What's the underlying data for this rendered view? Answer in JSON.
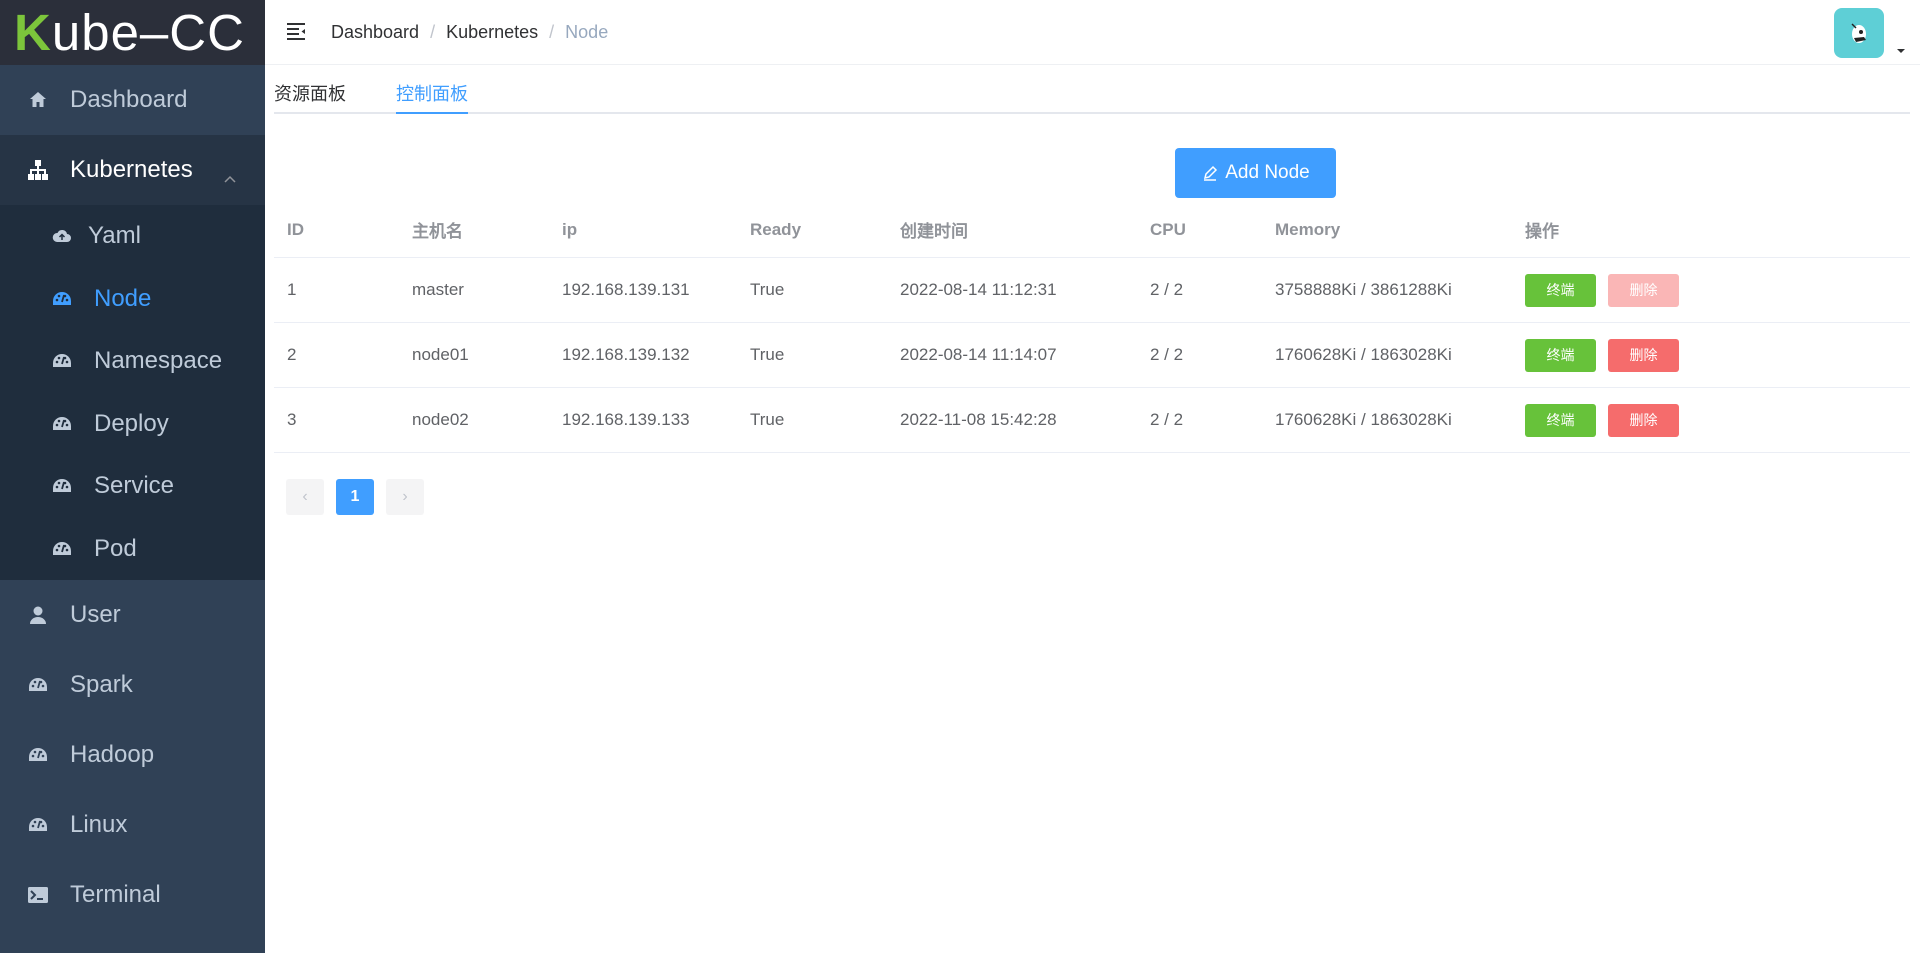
{
  "app": {
    "logo_prefix": "K",
    "logo_rest": "ube–CC"
  },
  "sidebar": {
    "items": [
      {
        "label": "Dashboard",
        "icon": "home-icon"
      },
      {
        "label": "Kubernetes",
        "icon": "sitemap-icon",
        "expanded": true,
        "children": [
          {
            "label": "Yaml",
            "icon": "cloud-upload-icon"
          },
          {
            "label": "Node",
            "icon": "dashboard-gauge-icon",
            "active": true
          },
          {
            "label": "Namespace",
            "icon": "dashboard-gauge-icon"
          },
          {
            "label": "Deploy",
            "icon": "dashboard-gauge-icon"
          },
          {
            "label": "Service",
            "icon": "dashboard-gauge-icon"
          },
          {
            "label": "Pod",
            "icon": "dashboard-gauge-icon"
          }
        ]
      },
      {
        "label": "User",
        "icon": "user-icon"
      },
      {
        "label": "Spark",
        "icon": "dashboard-gauge-icon"
      },
      {
        "label": "Hadoop",
        "icon": "dashboard-gauge-icon"
      },
      {
        "label": "Linux",
        "icon": "dashboard-gauge-icon"
      },
      {
        "label": "Terminal",
        "icon": "terminal-icon"
      }
    ]
  },
  "breadcrumb": [
    "Dashboard",
    "Kubernetes",
    "Node"
  ],
  "tabs": [
    {
      "label": "资源面板",
      "active": false
    },
    {
      "label": "控制面板",
      "active": true
    }
  ],
  "add_button": {
    "label": "Add Node"
  },
  "table": {
    "headers": [
      "ID",
      "主机名",
      "ip",
      "Ready",
      "创建时间",
      "CPU",
      "Memory",
      "操作"
    ],
    "rows": [
      {
        "id": "1",
        "host": "master",
        "ip": "192.168.139.131",
        "ready": "True",
        "time": "2022-08-14 11:12:31",
        "cpu": "2 / 2",
        "mem": "3758888Ki / 3861288Ki",
        "term": "终端",
        "del": "删除",
        "del_disabled": true
      },
      {
        "id": "2",
        "host": "node01",
        "ip": "192.168.139.132",
        "ready": "True",
        "time": "2022-08-14 11:14:07",
        "cpu": "2 / 2",
        "mem": "1760628Ki / 1863028Ki",
        "term": "终端",
        "del": "删除",
        "del_disabled": false
      },
      {
        "id": "3",
        "host": "node02",
        "ip": "192.168.139.133",
        "ready": "True",
        "time": "2022-11-08 15:42:28",
        "cpu": "2 / 2",
        "mem": "1760628Ki / 1863028Ki",
        "term": "终端",
        "del": "删除",
        "del_disabled": false
      }
    ]
  },
  "pagination": {
    "prev": "‹",
    "current": "1",
    "next": "›"
  },
  "colors": {
    "sidebar_bg": "#304156",
    "submenu_bg": "#1f2d3d",
    "accent": "#409eff",
    "success": "#67c23a",
    "danger": "#f56c6c"
  }
}
